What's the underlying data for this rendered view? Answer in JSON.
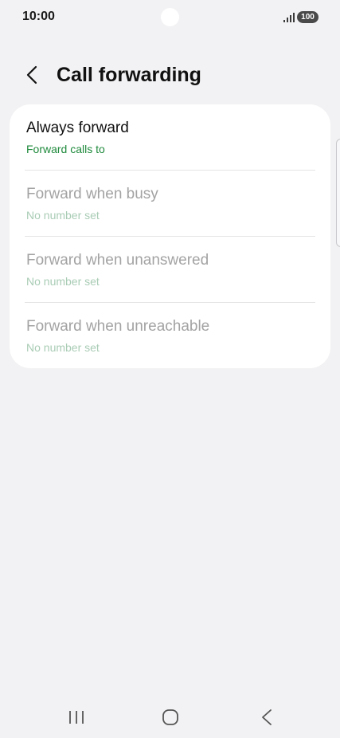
{
  "status_bar": {
    "time": "10:00",
    "battery": "100"
  },
  "header": {
    "title": "Call forwarding"
  },
  "forwarding_items": [
    {
      "title": "Always forward",
      "subtitle": "Forward calls to",
      "enabled": true
    },
    {
      "title": "Forward when busy",
      "subtitle": "No number set",
      "enabled": false
    },
    {
      "title": "Forward when unanswered",
      "subtitle": "No number set",
      "enabled": false
    },
    {
      "title": "Forward when unreachable",
      "subtitle": "No number set",
      "enabled": false
    }
  ],
  "colors": {
    "background": "#f2f2f4",
    "card": "#ffffff",
    "accent_green": "#1f8a3c",
    "disabled_text": "#a3a3a3",
    "disabled_subtitle": "#a9ccb5"
  },
  "icons": {
    "back": "chevron-left-icon",
    "signal": "signal-icon",
    "nav_recents": "recents-icon",
    "nav_home": "home-icon",
    "nav_back": "back-icon"
  }
}
